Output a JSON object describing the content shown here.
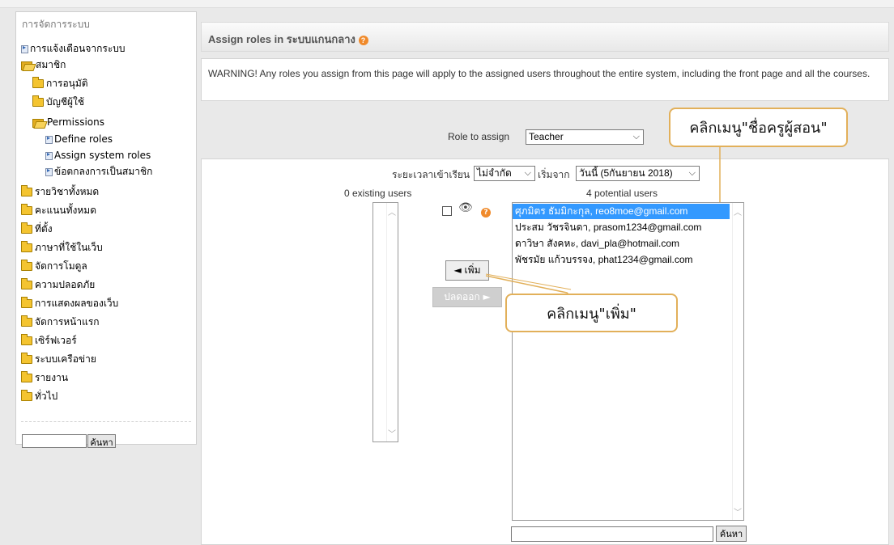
{
  "sidebar": {
    "title": "การจัดการระบบ",
    "items": [
      {
        "label": "การแจ้งเตือนจากระบบ",
        "icon": "doc-icon"
      },
      {
        "label": "สมาชิก",
        "icon": "folder-open-icon"
      },
      {
        "label": "การอนุมัติ",
        "icon": "folder-icon"
      },
      {
        "label": "บัญชีผู้ใช้",
        "icon": "folder-icon"
      },
      {
        "label": "Permissions",
        "icon": "folder-open-icon"
      },
      {
        "label": "Define roles",
        "icon": "doc-icon"
      },
      {
        "label": "Assign system roles",
        "icon": "doc-icon"
      },
      {
        "label": "ข้อตกลงการเป็นสมาชิก",
        "icon": "doc-icon"
      },
      {
        "label": "รายวิชาทั้งหมด",
        "icon": "folder-icon"
      },
      {
        "label": "คะแนนทั้งหมด",
        "icon": "folder-icon"
      },
      {
        "label": "ที่ตั้ง",
        "icon": "folder-icon"
      },
      {
        "label": "ภาษาที่ใช้ในเว็บ",
        "icon": "folder-icon"
      },
      {
        "label": "จัดการโมดูล",
        "icon": "folder-icon"
      },
      {
        "label": "ความปลอดภัย",
        "icon": "folder-icon"
      },
      {
        "label": "การแสดงผลของเว็บ",
        "icon": "folder-icon"
      },
      {
        "label": "จัดการหน้าแรก",
        "icon": "folder-icon"
      },
      {
        "label": "เซิร์ฟเวอร์",
        "icon": "folder-icon"
      },
      {
        "label": "ระบบเครือข่าย",
        "icon": "folder-icon"
      },
      {
        "label": "รายงาน",
        "icon": "folder-icon"
      },
      {
        "label": "ทั่วไป",
        "icon": "folder-icon"
      }
    ],
    "search_button": "ค้นหา"
  },
  "header": {
    "title": "Assign roles in ระบบแกนกลาง"
  },
  "warning": "WARNING! Any roles you assign from this page will apply to the assigned users throughout the entire system, including the front page and all the courses.",
  "role": {
    "label": "Role to assign",
    "selected": "Teacher"
  },
  "enrol": {
    "duration_label": "ระยะเวลาเข้าเรียน",
    "duration_value": "ไม่จำกัด",
    "start_label": "เริ่มจาก",
    "start_value": "วันนี้ (5กันยายน 2018)"
  },
  "existing": {
    "heading": "0 existing users"
  },
  "potential": {
    "heading": "4 potential users",
    "users": [
      "ศุภมิตร ธัมมิกะกุล, reo8moe@gmail.com",
      "ประสม วัชรจินดา, prasom1234@gmail.com",
      "ดาวิษา สังคหะ, davi_pla@hotmail.com",
      "พัชรมัย แก้วบรรจง, phat1234@gmail.com"
    ],
    "selected_index": 0
  },
  "buttons": {
    "add": "◄ เพิ่ม",
    "remove": "ปลดออก ►",
    "search": "ค้นหา"
  },
  "callouts": {
    "teacher_name": "คลิกเมนู\"ชื่อครูผู้สอน\"",
    "add": "คลิกเมนู\"เพิ่ม\""
  },
  "colors": {
    "selection": "#3399ff",
    "callout_border": "#e2b05a",
    "help_icon": "#f08a2b"
  }
}
